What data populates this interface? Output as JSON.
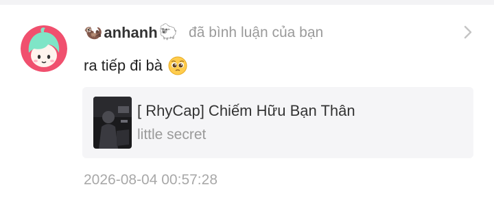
{
  "notification": {
    "username": "anhanh",
    "username_prefix_icon": "otter-icon",
    "username_suffix_icon": "sheep-icon",
    "username_prefix_glyph": "🦦",
    "username_suffix_glyph": "🐑",
    "action": "đã bình luận của bạn",
    "comment_text": "ra tiếp đi bà",
    "comment_emoji_icon": "pleading-face-icon",
    "timestamp": "2026-08-04 00:57:28"
  },
  "song": {
    "title": "[ RhyCap] Chiếm Hữu Bạn Thân",
    "artist": "little secret",
    "cover_icon": "album-cover-image"
  },
  "colors": {
    "avatar_bg": "#f0506e",
    "avatar_hair": "#7fe5c7",
    "card_bg": "#f5f5f7",
    "muted_text": "#9a9a9a"
  }
}
